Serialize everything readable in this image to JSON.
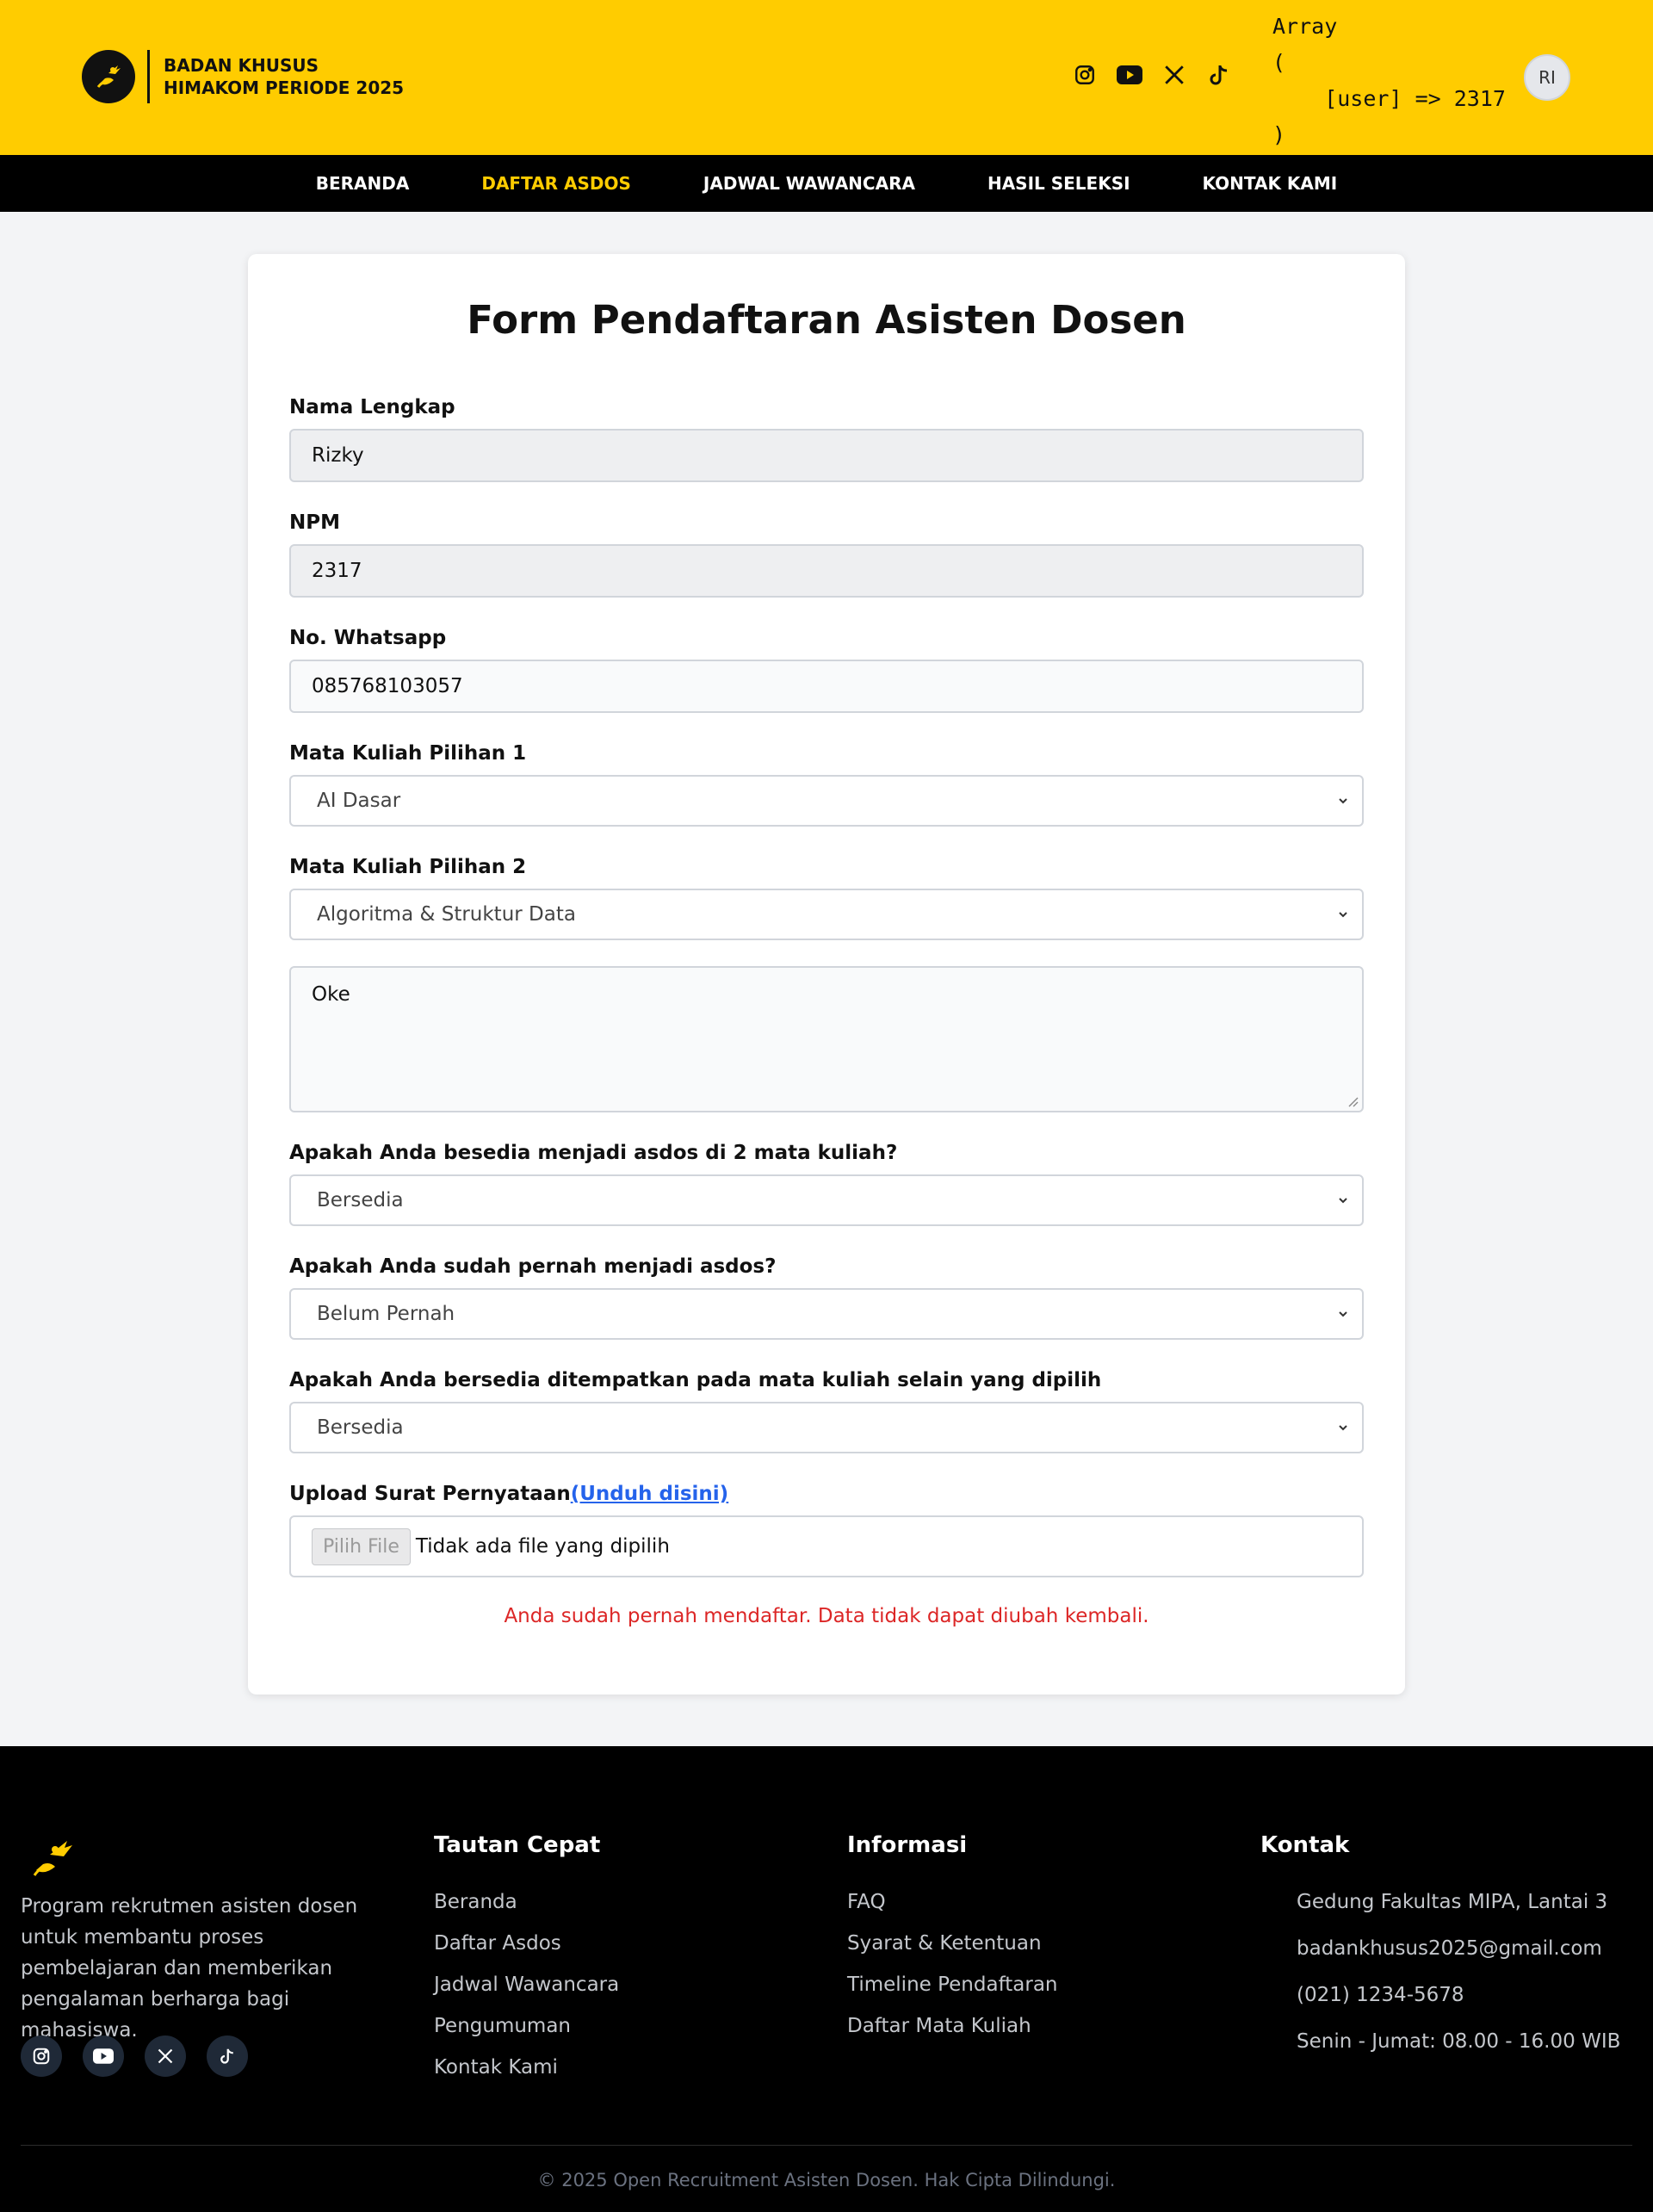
{
  "header": {
    "brand_line1": "BADAN KHUSUS",
    "brand_line2": "HIMAKOM PERIODE 2025",
    "social_icons": [
      "instagram-icon",
      "youtube-icon",
      "x-icon",
      "tiktok-icon"
    ],
    "debug_output": "Array\n(\n    [user] => 2317\n)",
    "avatar_initials": "RI",
    "accent_color": "#ffcc00"
  },
  "nav": {
    "items": [
      "BERANDA",
      "DAFTAR ASDOS",
      "JADWAL WAWANCARA",
      "HASIL SELEKSI",
      "KONTAK KAMI"
    ],
    "active": "DAFTAR ASDOS"
  },
  "form": {
    "title": "Form Pendaftaran Asisten Dosen",
    "nama_label": "Nama Lengkap",
    "nama_value": "Rizky",
    "npm_label": "NPM",
    "npm_value": "2317",
    "wa_label": "No. Whatsapp",
    "wa_value": "085768103057",
    "mk1_label": "Mata Kuliah Pilihan 1",
    "mk1_value": "AI Dasar",
    "mk2_label": "Mata Kuliah Pilihan 2",
    "mk2_value": "Algoritma & Struktur Data",
    "textarea_value": "Oke",
    "q1_label": "Apakah Anda besedia menjadi asdos di 2 mata kuliah?",
    "q1_value": "Bersedia",
    "q2_label": "Apakah Anda sudah pernah menjadi asdos?",
    "q2_value": "Belum Pernah",
    "q3_label": "Apakah Anda bersedia ditempatkan pada mata kuliah selain yang dipilih",
    "q3_value": "Bersedia",
    "upload_label": "Upload Surat Pernyataan",
    "upload_link": "(Unduh disini)",
    "file_button": "Pilih File",
    "file_status": "Tidak ada file yang dipilih",
    "error_message": "Anda sudah pernah mendaftar. Data tidak dapat diubah kembali.",
    "error_color": "#dc2626"
  },
  "footer": {
    "description": "Program rekrutmen asisten dosen untuk membantu proses pembelajaran dan memberikan pengalaman berharga bagi mahasiswa.",
    "quick_links_title": "Tautan Cepat",
    "quick_links": [
      "Beranda",
      "Daftar Asdos",
      "Jadwal Wawancara",
      "Pengumuman",
      "Kontak Kami"
    ],
    "info_title": "Informasi",
    "info_links": [
      "FAQ",
      "Syarat & Ketentuan",
      "Timeline Pendaftaran",
      "Daftar Mata Kuliah"
    ],
    "contact_title": "Kontak",
    "contact_items": [
      "Gedung Fakultas MIPA, Lantai 3",
      "badankhusus2025@gmail.com",
      "(021) 1234-5678",
      "Senin - Jumat: 08.00 - 16.00 WIB"
    ],
    "copyright": "© 2025 Open Recruitment Asisten Dosen. Hak Cipta Dilindungi."
  }
}
